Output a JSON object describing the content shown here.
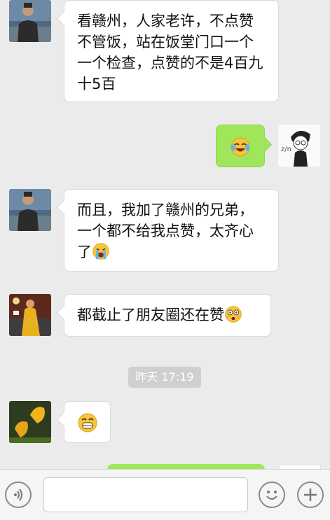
{
  "messages": [
    {
      "side": "left",
      "avatar": "man-by-sea",
      "text": "看赣州，人家老许，不点赞不管饭，站在饭堂门口一个一个检查，点赞的不是4百九十5百",
      "emoji": null
    },
    {
      "side": "right",
      "avatar": "sketch-boy",
      "text": "",
      "emoji": "laugh-cry-emoji"
    },
    {
      "side": "left",
      "avatar": "man-by-sea",
      "text": "而且，我加了赣州的兄弟，一个都不给我点赞，太齐心了",
      "emoji": "crying-emoji"
    },
    {
      "side": "left",
      "avatar": "person-yellow-coat",
      "text": "都截止了朋友圈还在赞",
      "emoji": "shocked-emoji"
    },
    {
      "side": "left",
      "avatar": "yellow-flowers",
      "text": "",
      "emoji": "grin-emoji"
    }
  ],
  "timestamp": "昨天 17:19",
  "input_bar": {
    "voice_icon": "voice-icon",
    "emoji_icon": "emoji-smile-icon",
    "plus_icon": "plus-icon",
    "input_value": ""
  },
  "colors": {
    "background": "#ebebeb",
    "bubble_in": "#ffffff",
    "bubble_out": "#9fe65a",
    "timestamp_bg": "#cfcfcf"
  }
}
